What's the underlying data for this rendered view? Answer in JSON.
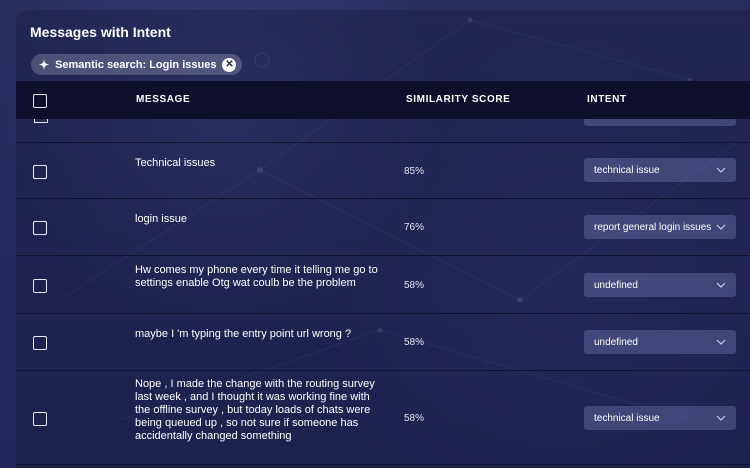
{
  "header": {
    "title": "Messages with Intent"
  },
  "filter_chip": {
    "label": "Semantic search: Login issues",
    "icon": "sparkle-icon",
    "remove_icon": "close-icon"
  },
  "table": {
    "columns": {
      "message": "MESSAGE",
      "similarity": "SIMILARITY SCORE",
      "intent": "INTENT"
    },
    "rows": [
      {
        "message": "Technical issues",
        "score": "85%",
        "intent": "technical issue"
      },
      {
        "message": "login issue",
        "score": "76%",
        "intent": "report general login issues"
      },
      {
        "message": "Hw comes my phone every time it telling me go to settings enable Otg wat coulb be the problem",
        "score": "58%",
        "intent": "undefined"
      },
      {
        "message": "maybe I 'm typing the entry point url wrong ?",
        "score": "58%",
        "intent": "undefined"
      },
      {
        "message": "Nope , I made the change with the routing survey last week , and I thought it was working fine with the offline survey , but today loads of chats were being queued up , so not sure if someone has accidentally changed something",
        "score": "58%",
        "intent": "technical issue"
      }
    ]
  }
}
